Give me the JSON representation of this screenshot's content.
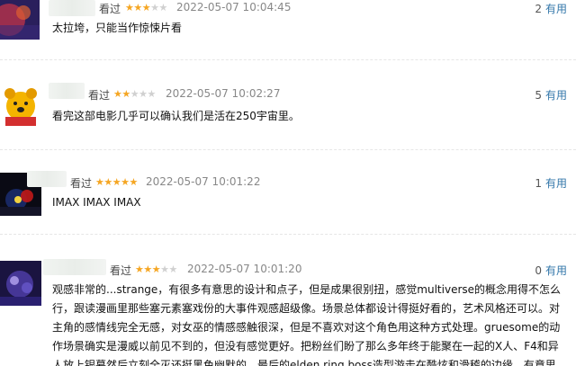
{
  "reviews": [
    {
      "status": "看过",
      "rating": 3,
      "time": "2022-05-07 10:04:45",
      "votes": "2",
      "useful_label": "有用",
      "text": "太拉垮，只能当作惊悚片看"
    },
    {
      "status": "看过",
      "rating": 2,
      "time": "2022-05-07 10:02:27",
      "votes": "5",
      "useful_label": "有用",
      "text": "看完这部电影几乎可以确认我们是活在250宇宙里。"
    },
    {
      "status": "看过",
      "rating": 5,
      "time": "2022-05-07 10:01:22",
      "votes": "1",
      "useful_label": "有用",
      "text": "IMAX IMAX IMAX"
    },
    {
      "status": "看过",
      "rating": 3,
      "time": "2022-05-07 10:01:20",
      "votes": "0",
      "useful_label": "有用",
      "text_lines": [
        "观感非常的...strange，有很多有意思的设计和点子，但是成果很别扭，感觉multiverse的概念用得不怎么",
        "行，跟读漫画里那些塞元素塞戏份的大事件观感超级像。场景总体都设计得挺好看的，艺术风格还可以。对",
        "主角的感情线完全无感，对女巫的情感感触很深，但是不喜欢对这个角色用这种方式处理。gruesome的动",
        "作场景确实是漫威以前见不到的，但没有感觉更好。把粉丝们盼了那么多年终于能聚在一起的X人、F4和异",
        "人放上银幕然后立刻全灭还挺黑色幽默的。最后的elden ring boss造型游走在酷炫和滑稽的边缘，有意思。"
      ]
    }
  ],
  "colors": {
    "star": "#f5a623",
    "star_empty": "#d0d0d0",
    "link": "#3377aa"
  }
}
